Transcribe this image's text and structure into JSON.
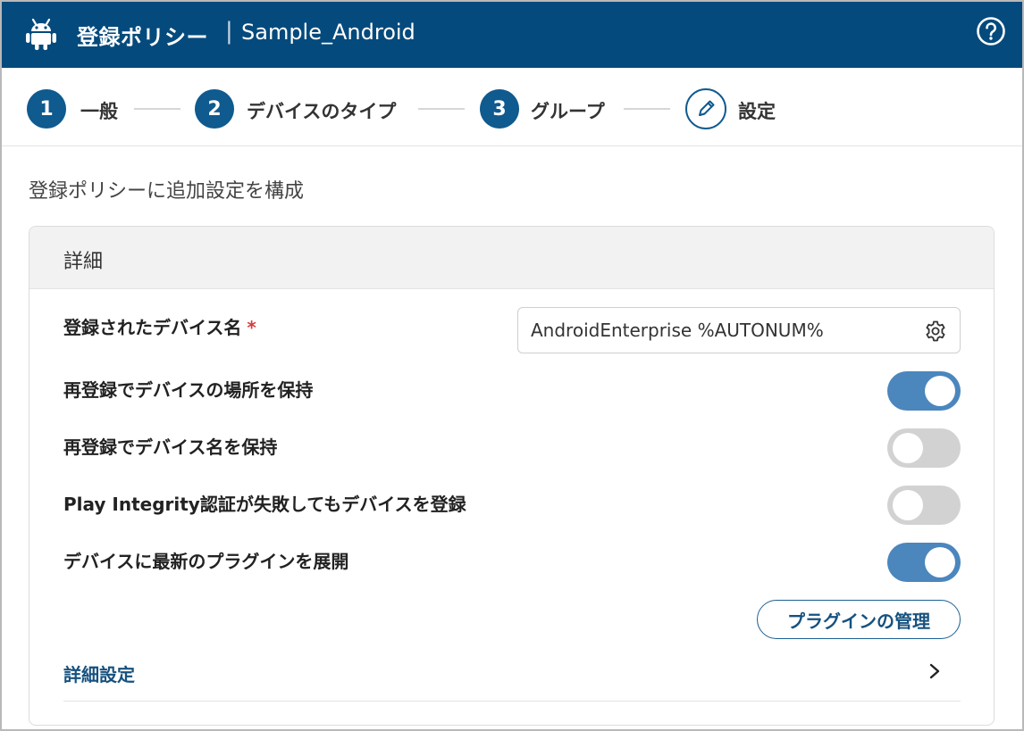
{
  "header": {
    "title": "登録ポリシー",
    "separator": "|",
    "subtitle": "Sample_Android",
    "icon": "android-icon",
    "help_icon": "help-circle-icon",
    "bg_color": "#054a7c"
  },
  "stepper": {
    "steps": [
      {
        "number": "1",
        "label": "一般"
      },
      {
        "number": "2",
        "label": "デバイスのタイプ"
      },
      {
        "number": "3",
        "label": "グループ"
      },
      {
        "icon": "pencil-icon",
        "label": "設定"
      }
    ],
    "accent_color": "#0f5a8e"
  },
  "intro": "登録ポリシーに追加設定を構成",
  "details": {
    "title": "詳細",
    "device_name": {
      "label": "登録されたデバイス名",
      "required": "*",
      "value": "AndroidEnterprise %AUTONUM%",
      "icon": "gear-icon"
    },
    "toggles": [
      {
        "label": "再登録でデバイスの場所を保持",
        "state": "on"
      },
      {
        "label": "再登録でデバイス名を保持",
        "state": "off"
      },
      {
        "label": "Play Integrity認証が失敗してもデバイスを登録",
        "state": "off"
      },
      {
        "label": "デバイスに最新のプラグインを展開",
        "state": "on"
      }
    ],
    "manage_plugins_button": "プラグインの管理",
    "advanced": {
      "label": "詳細設定",
      "icon": "chevron-right-icon"
    },
    "toggle_on_color": "#4b86bd",
    "toggle_off_color": "#d2d2d2"
  }
}
